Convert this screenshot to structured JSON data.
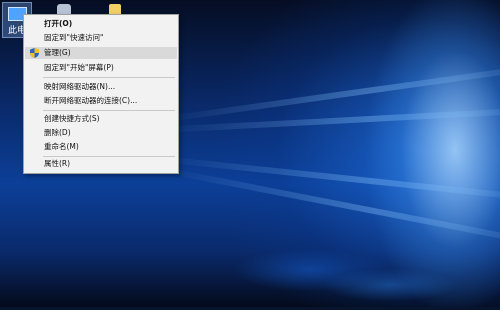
{
  "desktop": {
    "this_pc_label": "此电"
  },
  "context_menu": {
    "items": [
      {
        "label": "打开(O)"
      },
      {
        "label": "固定到\"快速访问\""
      },
      {
        "label": "管理(G)"
      },
      {
        "label": "固定到\"开始\"屏幕(P)"
      },
      {
        "label": "映射网络驱动器(N)..."
      },
      {
        "label": "断开网络驱动器的连接(C)..."
      },
      {
        "label": "创建快捷方式(S)"
      },
      {
        "label": "删除(D)"
      },
      {
        "label": "重命名(M)"
      },
      {
        "label": "属性(R)"
      }
    ],
    "highlighted_item": "管理(G)",
    "icons": {
      "manage": "admin-shield-icon"
    }
  },
  "colors": {
    "menu_background": "#f2f2f2",
    "menu_highlight": "#d9d9d9",
    "wallpaper_glow": "#7fc0ff"
  }
}
